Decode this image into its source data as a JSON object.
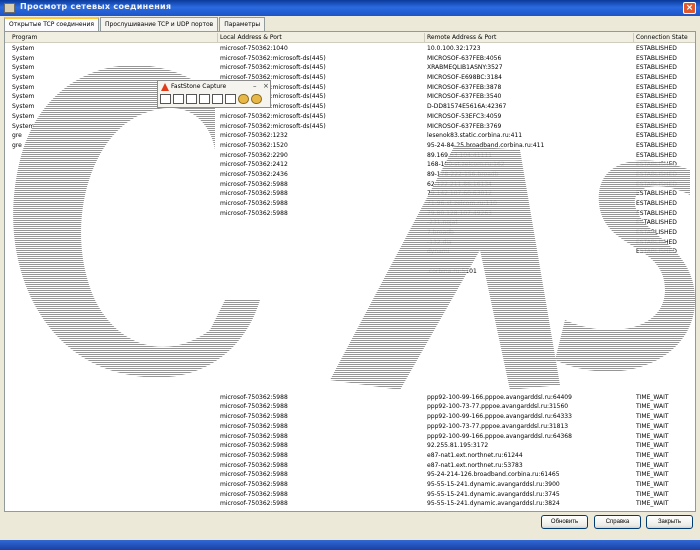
{
  "window": {
    "title": "Просмотр сетевых соединения",
    "close_label": "×"
  },
  "tabs": [
    {
      "label": "Открытые TCP соединения"
    },
    {
      "label": "Прослушивание TCP и UDP портов"
    },
    {
      "label": "Параметры"
    }
  ],
  "table": {
    "headers": [
      "Program",
      "Local Address & Port",
      "Remote Address & Port",
      "Connection State"
    ],
    "rows": [
      [
        "System",
        "microsof-750362:1040",
        "10.0.100.32:1723",
        "ESTABLISHED"
      ],
      [
        "System",
        "microsof-750362:microsoft-ds(445)",
        "MICROSOF-637FEB:4056",
        "ESTABLISHED"
      ],
      [
        "System",
        "microsof-750362:microsoft-ds(445)",
        "XRABMEQLIB1ASNY:3527",
        "ESTABLISHED"
      ],
      [
        "System",
        "microsof-750362:microsoft-ds(445)",
        "MICROSOF-E698BC:3184",
        "ESTABLISHED"
      ],
      [
        "System",
        "microsof-750362:microsoft-ds(445)",
        "MICROSOF-637FEB:3878",
        "ESTABLISHED"
      ],
      [
        "System",
        "microsof-750362:microsoft-ds(445)",
        "MICROSOF-637FEB:3540",
        "ESTABLISHED"
      ],
      [
        "System",
        "microsof-750362:microsoft-ds(445)",
        "D-DD81574E5616A:42367",
        "ESTABLISHED"
      ],
      [
        "System",
        "microsof-750362:microsoft-ds(445)",
        "MICROSOF-53EFC3:4059",
        "ESTABLISHED"
      ],
      [
        "System",
        "microsof-750362:microsoft-ds(445)",
        "MICROSOF-637FEB:3769",
        "ESTABLISHED"
      ],
      [
        "gre",
        "microsof-750362:1232",
        "lesenok83.static.corbina.ru:411",
        "ESTABLISHED"
      ],
      [
        "gre",
        "microsof-750362:1520",
        "95-24-84-25.broadband.corbina.ru:411",
        "ESTABLISHED"
      ],
      [
        "",
        "microsof-750362:2290",
        "89.169.63.104:41111",
        "ESTABLISHED"
      ],
      [
        "",
        "microsof-750362:2412",
        "168-100-st.zelcom.ru:162",
        "ESTABLISHED"
      ],
      [
        "",
        "microsof-750362:2436",
        "89-178-222-156.broadb",
        "ESTABLISHED"
      ],
      [
        "",
        "microsof-750362:5988",
        "62.122.211.86:16134",
        "ESTABLISHED"
      ],
      [
        "",
        "microsof-750362:5988",
        "79.142.107.60:63012",
        "ESTABLISHED"
      ],
      [
        "",
        "microsof-750362:5988",
        "71-96-st.zelcom.ru:110",
        "ESTABLISHED"
      ],
      [
        "",
        "microsof-750362:5988",
        "79.80.128.107:49263",
        "ESTABLISHED"
      ],
      [
        "",
        "",
        "-231.nojat",
        "ESTABLISHED"
      ],
      [
        "",
        "",
        "7.broadb",
        "ESTABLISHED"
      ],
      [
        "",
        "",
        "-132.dia",
        "ESTABLISHED"
      ],
      [
        "",
        "",
        "dynami",
        "ESTABLISHED"
      ],
      [
        "",
        "",
        "",
        ""
      ],
      [
        "",
        "",
        ".corbina.ru:5101",
        ""
      ],
      [
        "",
        "",
        "",
        ""
      ],
      [
        "",
        "",
        "",
        ""
      ],
      [
        "",
        "",
        "",
        ""
      ],
      [
        "",
        "",
        "",
        ""
      ],
      [
        "",
        "",
        "",
        ""
      ],
      [
        "",
        "",
        "",
        ""
      ],
      [
        "",
        "",
        "",
        ""
      ],
      [
        "",
        "",
        "",
        ""
      ],
      [
        "",
        "",
        "",
        ""
      ],
      [
        "",
        "",
        "",
        ""
      ],
      [
        "",
        "",
        "",
        ""
      ],
      [
        "",
        "",
        "",
        ""
      ],
      [
        "",
        "microsof-750362:5988",
        "ppp92-100-99-166.pppoe.avangarddsl.ru:64409",
        "TIME_WAIT"
      ],
      [
        "",
        "microsof-750362:5988",
        "ppp92-100-73-77.pppoe.avangarddsl.ru:31560",
        "TIME_WAIT"
      ],
      [
        "",
        "microsof-750362:5988",
        "ppp92-100-99-166.pppoe.avangarddsl.ru:64333",
        "TIME_WAIT"
      ],
      [
        "",
        "microsof-750362:5988",
        "ppp92-100-73-77.pppoe.avangarddsl.ru:31813",
        "TIME_WAIT"
      ],
      [
        "",
        "microsof-750362:5988",
        "ppp92-100-99-166.pppoe.avangarddsl.ru:64368",
        "TIME_WAIT"
      ],
      [
        "",
        "microsof-750362:5988",
        "92.255.81.195:3172",
        "TIME_WAIT"
      ],
      [
        "",
        "microsof-750362:5988",
        "e87-nat1.ext.northnet.ru:61244",
        "TIME_WAIT"
      ],
      [
        "",
        "microsof-750362:5988",
        "e87-nat1.ext.northnet.ru:53783",
        "TIME_WAIT"
      ],
      [
        "",
        "microsof-750362:5988",
        "95-24-214-126.broadband.corbina.ru:61465",
        "TIME_WAIT"
      ],
      [
        "",
        "microsof-750362:5988",
        "95-55-15-241.dynamic.avangarddsl.ru:3900",
        "TIME_WAIT"
      ],
      [
        "",
        "microsof-750362:5988",
        "95-55-15-241.dynamic.avangarddsl.ru:3745",
        "TIME_WAIT"
      ],
      [
        "",
        "microsof-750362:5988",
        "95-55-15-241.dynamic.avangarddsl.ru:3824",
        "TIME_WAIT"
      ]
    ]
  },
  "faststone": {
    "title": "FastStone Capture",
    "min_label": "–",
    "close_label": "×"
  },
  "buttons": {
    "refresh": "Обновить",
    "help": "Справка",
    "close": "Закрыть"
  },
  "colors": {
    "title_bar": "#2a6ae0",
    "active_tab": "#ffc83c",
    "watermark": "#999999"
  }
}
